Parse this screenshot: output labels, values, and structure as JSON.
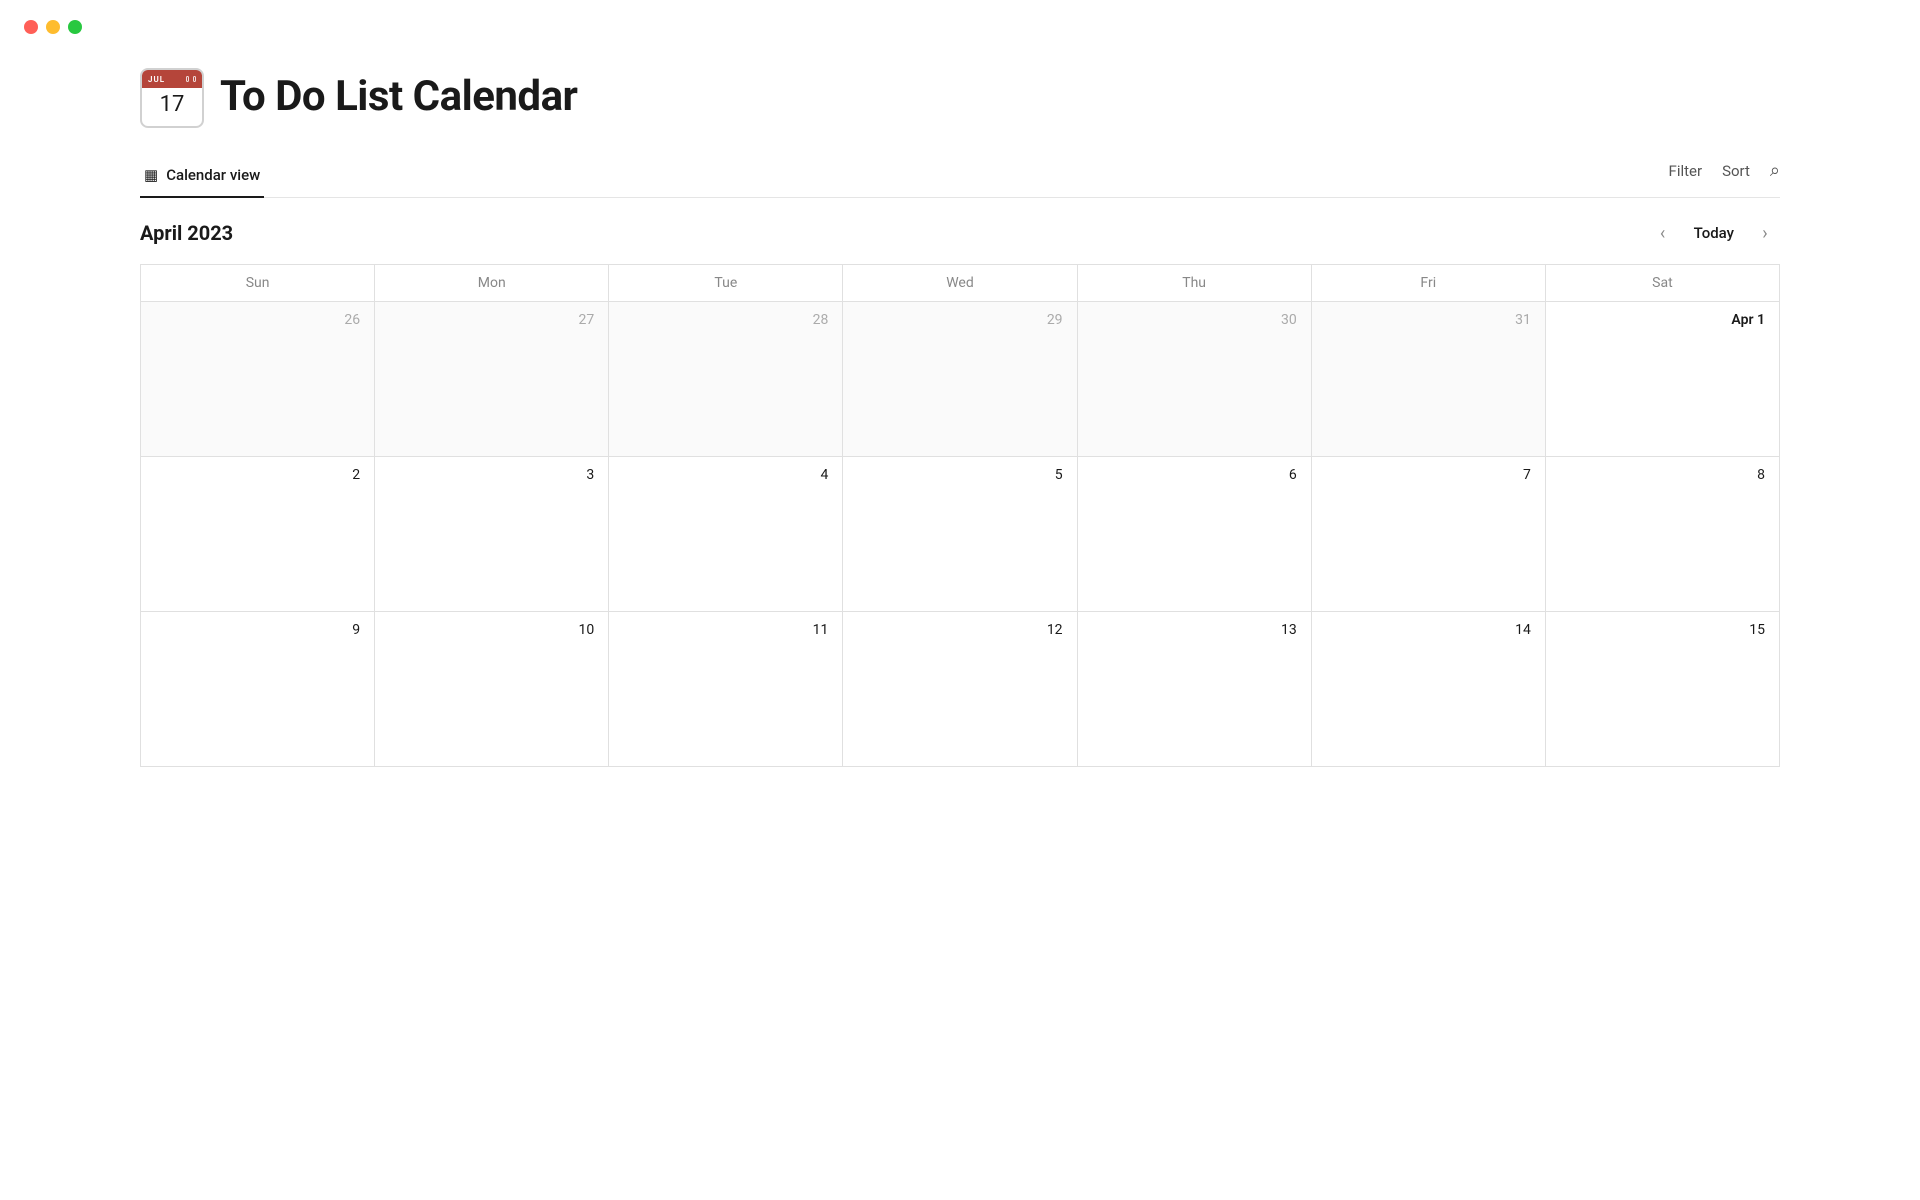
{
  "app": {
    "title": "To Do List Calendar",
    "icon_month": "JUL",
    "icon_day": "17"
  },
  "traffic_lights": {
    "red_label": "close",
    "yellow_label": "minimize",
    "green_label": "maximize"
  },
  "view_tab": {
    "label": "Calendar view",
    "icon": "📅"
  },
  "toolbar": {
    "filter_label": "Filter",
    "sort_label": "Sort"
  },
  "calendar": {
    "month_year": "April 2023",
    "today_label": "Today",
    "days_of_week": [
      "Sun",
      "Mon",
      "Tue",
      "Wed",
      "Thu",
      "Fri",
      "Sat"
    ],
    "weeks": [
      [
        {
          "number": "26",
          "prev": true
        },
        {
          "number": "27",
          "prev": true
        },
        {
          "number": "28",
          "prev": true
        },
        {
          "number": "29",
          "prev": true
        },
        {
          "number": "30",
          "prev": true
        },
        {
          "number": "31",
          "prev": true
        },
        {
          "number": "Apr 1",
          "first": true
        }
      ],
      [
        {
          "number": "2"
        },
        {
          "number": "3"
        },
        {
          "number": "4"
        },
        {
          "number": "5"
        },
        {
          "number": "6"
        },
        {
          "number": "7"
        },
        {
          "number": "8"
        }
      ],
      [
        {
          "number": "9"
        },
        {
          "number": "10"
        },
        {
          "number": "11"
        },
        {
          "number": "12"
        },
        {
          "number": "13"
        },
        {
          "number": "14"
        },
        {
          "number": "15"
        }
      ]
    ]
  }
}
